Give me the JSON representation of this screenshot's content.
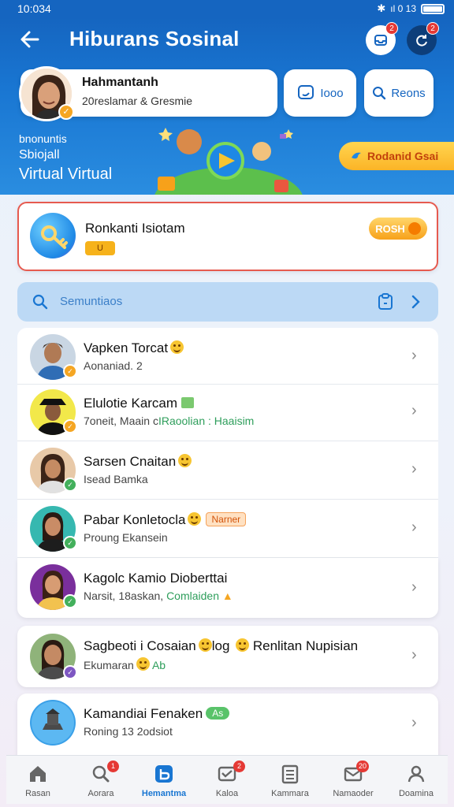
{
  "status_bar": {
    "time": "10:034",
    "signal": "ıl 0 13"
  },
  "header": {
    "title": "Hiburans Sosinal",
    "notif_badge": "2",
    "sync_badge": "2"
  },
  "profile": {
    "name": "Hahmantanh",
    "subtitle": "20reslamar & Gresmie"
  },
  "actions": {
    "video_label": "Iooo",
    "search_label": "Reons"
  },
  "banner": {
    "line1": "bnonuntis",
    "line2": "Sbiojall",
    "line3": "Virtual Virtual",
    "cta": "Rodanid Gsai"
  },
  "featured": {
    "title": "Ronkanti Isiotam",
    "chip": "U",
    "button": "ROSH"
  },
  "search": {
    "placeholder": "Semuntiaos"
  },
  "contacts": [
    {
      "name": "Vapken Torcat",
      "subtitle": "Aonaniad. 2"
    },
    {
      "name": "Elulotie Karcam",
      "subtitle_prefix": "7oneit, Maain c",
      "subtitle_green": "IRaoolian : Haaisim"
    },
    {
      "name": "Sarsen Cnaitan",
      "subtitle": "Isead Bamka"
    },
    {
      "name": "Pabar Konletocla",
      "tag": "Narner",
      "subtitle": "Proung Ekansein"
    },
    {
      "name": "Kagolc Kamio Dioberttai",
      "subtitle_prefix": "Narsit, 18askan, ",
      "subtitle_green": "Comlaiden"
    },
    {
      "name": "Sagbeoti i Cosaian",
      "name_mid": "log",
      "name_suffix": "Renlitan Nupisian",
      "subtitle": "Ekumaran",
      "subtitle_green": "Ab"
    },
    {
      "name": "Kamandiai Fenaken",
      "tag": "As",
      "subtitle": "Roning 13 2odsiot"
    }
  ],
  "bottom_nav": [
    {
      "label": "Rasan",
      "icon": "home-icon"
    },
    {
      "label": "Aorara",
      "icon": "search-person-icon",
      "badge": "1"
    },
    {
      "label": "Hemantma",
      "icon": "brand-icon",
      "active": true
    },
    {
      "label": "Kaloa",
      "icon": "message-icon",
      "badge": "2"
    },
    {
      "label": "Kammara",
      "icon": "list-icon"
    },
    {
      "label": "Namaoder",
      "icon": "mail-icon",
      "badge": "20"
    },
    {
      "label": "Doamina",
      "icon": "profile-icon"
    }
  ],
  "colors": {
    "primary": "#1976d2",
    "accent": "#f6b21b",
    "alert": "#e53935",
    "highlight_border": "#e65a4f"
  }
}
